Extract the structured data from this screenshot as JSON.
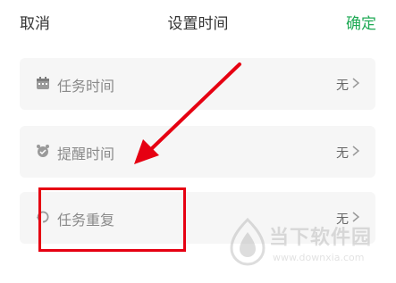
{
  "header": {
    "cancel": "取消",
    "title": "设置时间",
    "confirm": "确定"
  },
  "rows": [
    {
      "label": "任务时间",
      "value": "无",
      "icon": "calendar-icon"
    },
    {
      "label": "提醒时间",
      "value": "无",
      "icon": "alarm-clock-icon"
    },
    {
      "label": "任务重复",
      "value": "无",
      "icon": "repeat-icon"
    }
  ],
  "watermark": {
    "text": "当下软件园",
    "url": "www.downxia.com"
  },
  "colors": {
    "accent": "#1faa55",
    "annotation": "#e60012",
    "row_bg": "#f6f6f6"
  }
}
